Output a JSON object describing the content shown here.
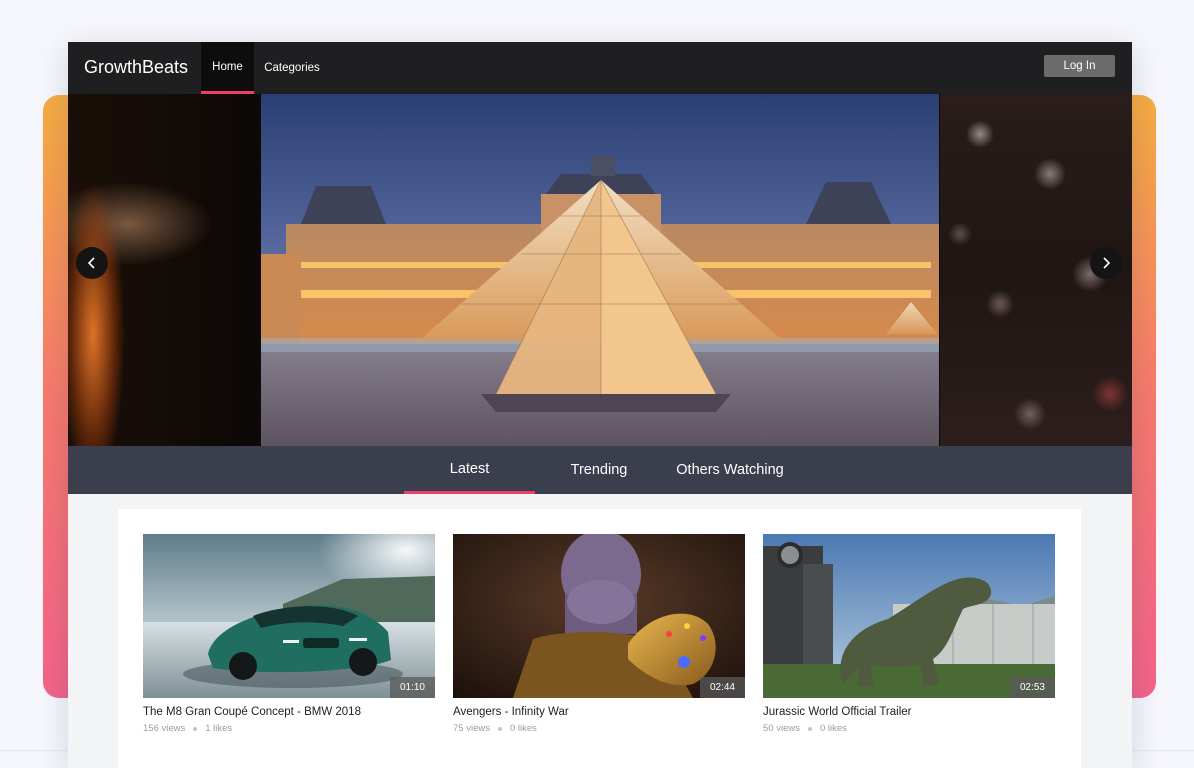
{
  "navbar": {
    "brand": "GrowthBeats",
    "items": [
      {
        "label": "Home",
        "active": true
      },
      {
        "label": "Categories",
        "active": false
      }
    ],
    "login_label": "Log In"
  },
  "carousel": {
    "prev_icon": "chevron-left-icon",
    "next_icon": "chevron-right-icon"
  },
  "tabs": [
    {
      "label": "Latest",
      "active": true
    },
    {
      "label": "Trending",
      "active": false
    },
    {
      "label": "Others Watching",
      "active": false
    }
  ],
  "videos": [
    {
      "title": "The M8 Gran Coupé Concept - BMW 2018",
      "duration": "01:10",
      "views": "156 views",
      "likes": "1 likes"
    },
    {
      "title": "Avengers - Infinity War",
      "duration": "02:44",
      "views": "75 views",
      "likes": "0 likes"
    },
    {
      "title": "Jurassic World Official Trailer",
      "duration": "02:53",
      "views": "50 views",
      "likes": "0 likes"
    }
  ],
  "colors": {
    "accent": "#ee3f6b",
    "navbar_bg": "#1f1f21",
    "tabbar_bg": "#3b3e4c",
    "gradient_top": "#f6ad42",
    "gradient_bottom": "#f4638a"
  }
}
